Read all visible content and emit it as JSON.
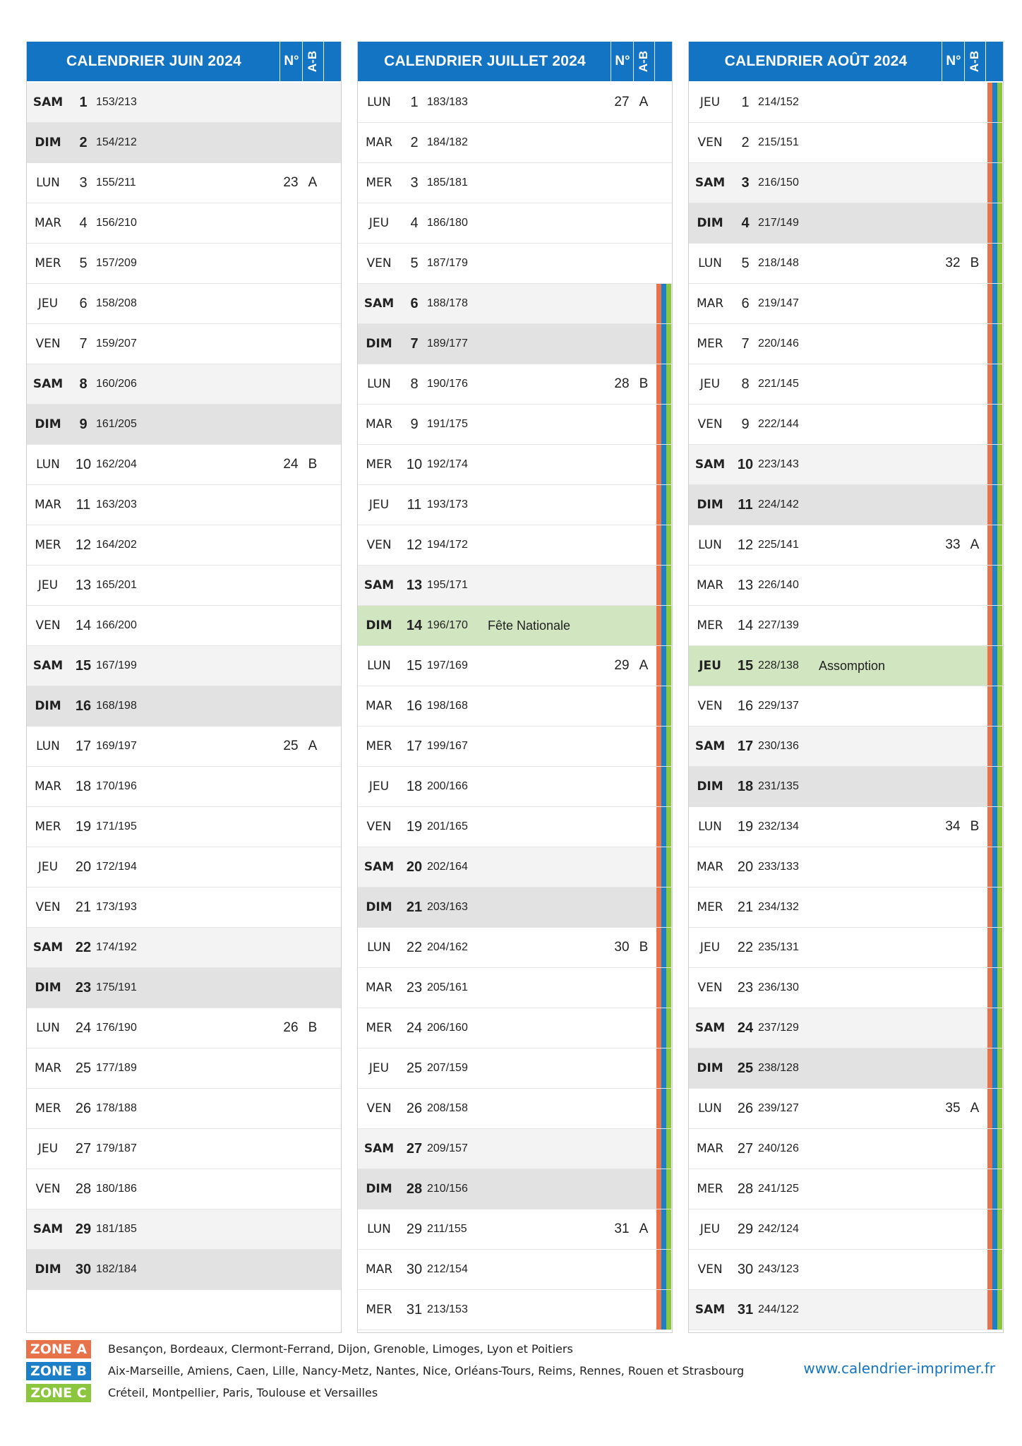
{
  "colors": {
    "header": "#1474c4",
    "zone_a": "#e8724a",
    "zone_b": "#1e7fc9",
    "zone_c": "#8cc63f",
    "holiday": "#d1e6c0"
  },
  "header_labels": {
    "week_no": "N°",
    "week_ab": "A-B"
  },
  "months": [
    {
      "title": "CALENDRIER JUIN 2024",
      "days": [
        {
          "dow": "SAM",
          "day": "1",
          "doy": "153/213",
          "type": "sat"
        },
        {
          "dow": "DIM",
          "day": "2",
          "doy": "154/212",
          "type": "sun"
        },
        {
          "dow": "LUN",
          "day": "3",
          "doy": "155/211",
          "week": "23",
          "ab": "A"
        },
        {
          "dow": "MAR",
          "day": "4",
          "doy": "156/210"
        },
        {
          "dow": "MER",
          "day": "5",
          "doy": "157/209"
        },
        {
          "dow": "JEU",
          "day": "6",
          "doy": "158/208"
        },
        {
          "dow": "VEN",
          "day": "7",
          "doy": "159/207"
        },
        {
          "dow": "SAM",
          "day": "8",
          "doy": "160/206",
          "type": "sat"
        },
        {
          "dow": "DIM",
          "day": "9",
          "doy": "161/205",
          "type": "sun"
        },
        {
          "dow": "LUN",
          "day": "10",
          "doy": "162/204",
          "week": "24",
          "ab": "B"
        },
        {
          "dow": "MAR",
          "day": "11",
          "doy": "163/203"
        },
        {
          "dow": "MER",
          "day": "12",
          "doy": "164/202"
        },
        {
          "dow": "JEU",
          "day": "13",
          "doy": "165/201"
        },
        {
          "dow": "VEN",
          "day": "14",
          "doy": "166/200"
        },
        {
          "dow": "SAM",
          "day": "15",
          "doy": "167/199",
          "type": "sat"
        },
        {
          "dow": "DIM",
          "day": "16",
          "doy": "168/198",
          "type": "sun"
        },
        {
          "dow": "LUN",
          "day": "17",
          "doy": "169/197",
          "week": "25",
          "ab": "A"
        },
        {
          "dow": "MAR",
          "day": "18",
          "doy": "170/196"
        },
        {
          "dow": "MER",
          "day": "19",
          "doy": "171/195"
        },
        {
          "dow": "JEU",
          "day": "20",
          "doy": "172/194"
        },
        {
          "dow": "VEN",
          "day": "21",
          "doy": "173/193"
        },
        {
          "dow": "SAM",
          "day": "22",
          "doy": "174/192",
          "type": "sat"
        },
        {
          "dow": "DIM",
          "day": "23",
          "doy": "175/191",
          "type": "sun"
        },
        {
          "dow": "LUN",
          "day": "24",
          "doy": "176/190",
          "week": "26",
          "ab": "B"
        },
        {
          "dow": "MAR",
          "day": "25",
          "doy": "177/189"
        },
        {
          "dow": "MER",
          "day": "26",
          "doy": "178/188"
        },
        {
          "dow": "JEU",
          "day": "27",
          "doy": "179/187"
        },
        {
          "dow": "VEN",
          "day": "28",
          "doy": "180/186"
        },
        {
          "dow": "SAM",
          "day": "29",
          "doy": "181/185",
          "type": "sat"
        },
        {
          "dow": "DIM",
          "day": "30",
          "doy": "182/184",
          "type": "sun"
        }
      ]
    },
    {
      "title": "CALENDRIER JUILLET 2024",
      "days": [
        {
          "dow": "LUN",
          "day": "1",
          "doy": "183/183",
          "week": "27",
          "ab": "A"
        },
        {
          "dow": "MAR",
          "day": "2",
          "doy": "184/182"
        },
        {
          "dow": "MER",
          "day": "3",
          "doy": "185/181"
        },
        {
          "dow": "JEU",
          "day": "4",
          "doy": "186/180"
        },
        {
          "dow": "VEN",
          "day": "5",
          "doy": "187/179"
        },
        {
          "dow": "SAM",
          "day": "6",
          "doy": "188/178",
          "type": "sat",
          "zones": true
        },
        {
          "dow": "DIM",
          "day": "7",
          "doy": "189/177",
          "type": "sun",
          "zones": true
        },
        {
          "dow": "LUN",
          "day": "8",
          "doy": "190/176",
          "week": "28",
          "ab": "B",
          "zones": true
        },
        {
          "dow": "MAR",
          "day": "9",
          "doy": "191/175",
          "zones": true
        },
        {
          "dow": "MER",
          "day": "10",
          "doy": "192/174",
          "zones": true
        },
        {
          "dow": "JEU",
          "day": "11",
          "doy": "193/173",
          "zones": true
        },
        {
          "dow": "VEN",
          "day": "12",
          "doy": "194/172",
          "zones": true
        },
        {
          "dow": "SAM",
          "day": "13",
          "doy": "195/171",
          "type": "sat",
          "zones": true
        },
        {
          "dow": "DIM",
          "day": "14",
          "doy": "196/170",
          "type": "hol",
          "holiday": "Fête Nationale",
          "zones": true
        },
        {
          "dow": "LUN",
          "day": "15",
          "doy": "197/169",
          "week": "29",
          "ab": "A",
          "zones": true
        },
        {
          "dow": "MAR",
          "day": "16",
          "doy": "198/168",
          "zones": true
        },
        {
          "dow": "MER",
          "day": "17",
          "doy": "199/167",
          "zones": true
        },
        {
          "dow": "JEU",
          "day": "18",
          "doy": "200/166",
          "zones": true
        },
        {
          "dow": "VEN",
          "day": "19",
          "doy": "201/165",
          "zones": true
        },
        {
          "dow": "SAM",
          "day": "20",
          "doy": "202/164",
          "type": "sat",
          "zones": true
        },
        {
          "dow": "DIM",
          "day": "21",
          "doy": "203/163",
          "type": "sun",
          "zones": true
        },
        {
          "dow": "LUN",
          "day": "22",
          "doy": "204/162",
          "week": "30",
          "ab": "B",
          "zones": true
        },
        {
          "dow": "MAR",
          "day": "23",
          "doy": "205/161",
          "zones": true
        },
        {
          "dow": "MER",
          "day": "24",
          "doy": "206/160",
          "zones": true
        },
        {
          "dow": "JEU",
          "day": "25",
          "doy": "207/159",
          "zones": true
        },
        {
          "dow": "VEN",
          "day": "26",
          "doy": "208/158",
          "zones": true
        },
        {
          "dow": "SAM",
          "day": "27",
          "doy": "209/157",
          "type": "sat",
          "zones": true
        },
        {
          "dow": "DIM",
          "day": "28",
          "doy": "210/156",
          "type": "sun",
          "zones": true
        },
        {
          "dow": "LUN",
          "day": "29",
          "doy": "211/155",
          "week": "31",
          "ab": "A",
          "zones": true
        },
        {
          "dow": "MAR",
          "day": "30",
          "doy": "212/154",
          "zones": true
        },
        {
          "dow": "MER",
          "day": "31",
          "doy": "213/153",
          "zones": true
        }
      ]
    },
    {
      "title": "CALENDRIER AOÛT 2024",
      "days": [
        {
          "dow": "JEU",
          "day": "1",
          "doy": "214/152",
          "zones": true
        },
        {
          "dow": "VEN",
          "day": "2",
          "doy": "215/151",
          "zones": true
        },
        {
          "dow": "SAM",
          "day": "3",
          "doy": "216/150",
          "type": "sat",
          "zones": true
        },
        {
          "dow": "DIM",
          "day": "4",
          "doy": "217/149",
          "type": "sun",
          "zones": true
        },
        {
          "dow": "LUN",
          "day": "5",
          "doy": "218/148",
          "week": "32",
          "ab": "B",
          "zones": true
        },
        {
          "dow": "MAR",
          "day": "6",
          "doy": "219/147",
          "zones": true
        },
        {
          "dow": "MER",
          "day": "7",
          "doy": "220/146",
          "zones": true
        },
        {
          "dow": "JEU",
          "day": "8",
          "doy": "221/145",
          "zones": true
        },
        {
          "dow": "VEN",
          "day": "9",
          "doy": "222/144",
          "zones": true
        },
        {
          "dow": "SAM",
          "day": "10",
          "doy": "223/143",
          "type": "sat",
          "zones": true
        },
        {
          "dow": "DIM",
          "day": "11",
          "doy": "224/142",
          "type": "sun",
          "zones": true
        },
        {
          "dow": "LUN",
          "day": "12",
          "doy": "225/141",
          "week": "33",
          "ab": "A",
          "zones": true
        },
        {
          "dow": "MAR",
          "day": "13",
          "doy": "226/140",
          "zones": true
        },
        {
          "dow": "MER",
          "day": "14",
          "doy": "227/139",
          "zones": true
        },
        {
          "dow": "JEU",
          "day": "15",
          "doy": "228/138",
          "type": "hol",
          "holiday": "Assomption",
          "zones": true
        },
        {
          "dow": "VEN",
          "day": "16",
          "doy": "229/137",
          "zones": true
        },
        {
          "dow": "SAM",
          "day": "17",
          "doy": "230/136",
          "type": "sat",
          "zones": true
        },
        {
          "dow": "DIM",
          "day": "18",
          "doy": "231/135",
          "type": "sun",
          "zones": true
        },
        {
          "dow": "LUN",
          "day": "19",
          "doy": "232/134",
          "week": "34",
          "ab": "B",
          "zones": true
        },
        {
          "dow": "MAR",
          "day": "20",
          "doy": "233/133",
          "zones": true
        },
        {
          "dow": "MER",
          "day": "21",
          "doy": "234/132",
          "zones": true
        },
        {
          "dow": "JEU",
          "day": "22",
          "doy": "235/131",
          "zones": true
        },
        {
          "dow": "VEN",
          "day": "23",
          "doy": "236/130",
          "zones": true
        },
        {
          "dow": "SAM",
          "day": "24",
          "doy": "237/129",
          "type": "sat",
          "zones": true
        },
        {
          "dow": "DIM",
          "day": "25",
          "doy": "238/128",
          "type": "sun",
          "zones": true
        },
        {
          "dow": "LUN",
          "day": "26",
          "doy": "239/127",
          "week": "35",
          "ab": "A",
          "zones": true
        },
        {
          "dow": "MAR",
          "day": "27",
          "doy": "240/126",
          "zones": true
        },
        {
          "dow": "MER",
          "day": "28",
          "doy": "241/125",
          "zones": true
        },
        {
          "dow": "JEU",
          "day": "29",
          "doy": "242/124",
          "zones": true
        },
        {
          "dow": "VEN",
          "day": "30",
          "doy": "243/123",
          "zones": true
        },
        {
          "dow": "SAM",
          "day": "31",
          "doy": "244/122",
          "type": "sat",
          "zones": true
        }
      ]
    }
  ],
  "legend": [
    {
      "label": "ZONE A",
      "cities": "Besançon, Bordeaux, Clermont-Ferrand, Dijon, Grenoble, Limoges, Lyon et Poitiers",
      "color": "#e8724a"
    },
    {
      "label": "ZONE B",
      "cities": "Aix-Marseille, Amiens, Caen, Lille, Nancy-Metz, Nantes, Nice, Orléans-Tours, Reims, Rennes, Rouen et Strasbourg",
      "color": "#1e7fc9"
    },
    {
      "label": "ZONE C",
      "cities": "Créteil, Montpellier, Paris, Toulouse et Versailles",
      "color": "#8cc63f"
    }
  ],
  "website": "www.calendrier-imprimer.fr"
}
